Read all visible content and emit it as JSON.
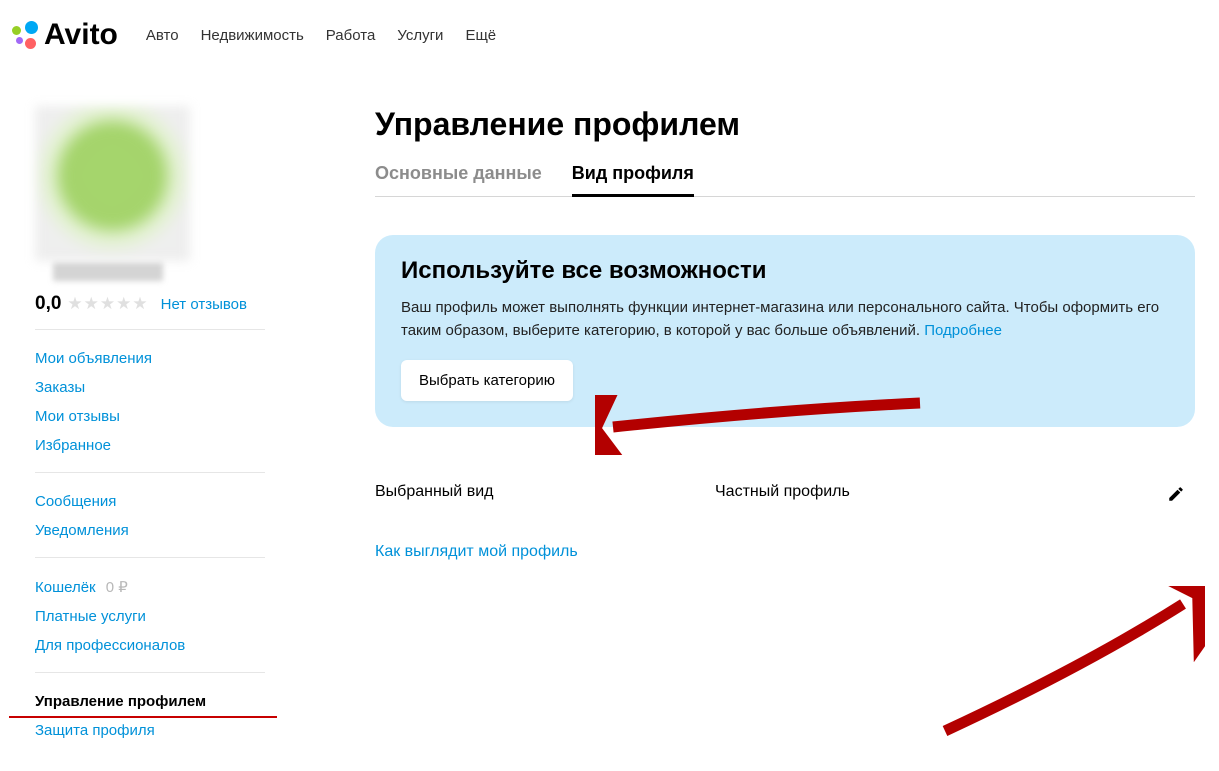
{
  "header": {
    "brand": "Avito",
    "nav": {
      "auto": "Авто",
      "realty": "Недвижимость",
      "jobs": "Работа",
      "services": "Услуги",
      "more": "Ещё"
    }
  },
  "sidebar": {
    "rating": "0,0",
    "no_reviews": "Нет отзывов",
    "group1": {
      "my_ads": "Мои объявления",
      "orders": "Заказы",
      "my_reviews": "Мои отзывы",
      "favorites": "Избранное"
    },
    "group2": {
      "messages": "Сообщения",
      "notifications": "Уведомления"
    },
    "group3": {
      "wallet": "Кошелёк",
      "wallet_value": "0 ₽",
      "paid": "Платные услуги",
      "pro": "Для профессионалов"
    },
    "group4": {
      "manage": "Управление профилем",
      "security": "Защита профиля"
    }
  },
  "content": {
    "title": "Управление профилем",
    "tabs": {
      "basic": "Основные данные",
      "profile_view": "Вид профиля"
    },
    "promo": {
      "title": "Используйте все возможности",
      "text": "Ваш профиль может выполнять функции интернет-магазина или персонального сайта. Чтобы оформить его таким образом, выберите категорию, в которой у вас больше объявлений. ",
      "more": "Подробнее",
      "button": "Выбрать категорию"
    },
    "selected_view_label": "Выбранный вид",
    "selected_view_value": "Частный профиль",
    "profile_preview_link": "Как выглядит мой профиль"
  }
}
